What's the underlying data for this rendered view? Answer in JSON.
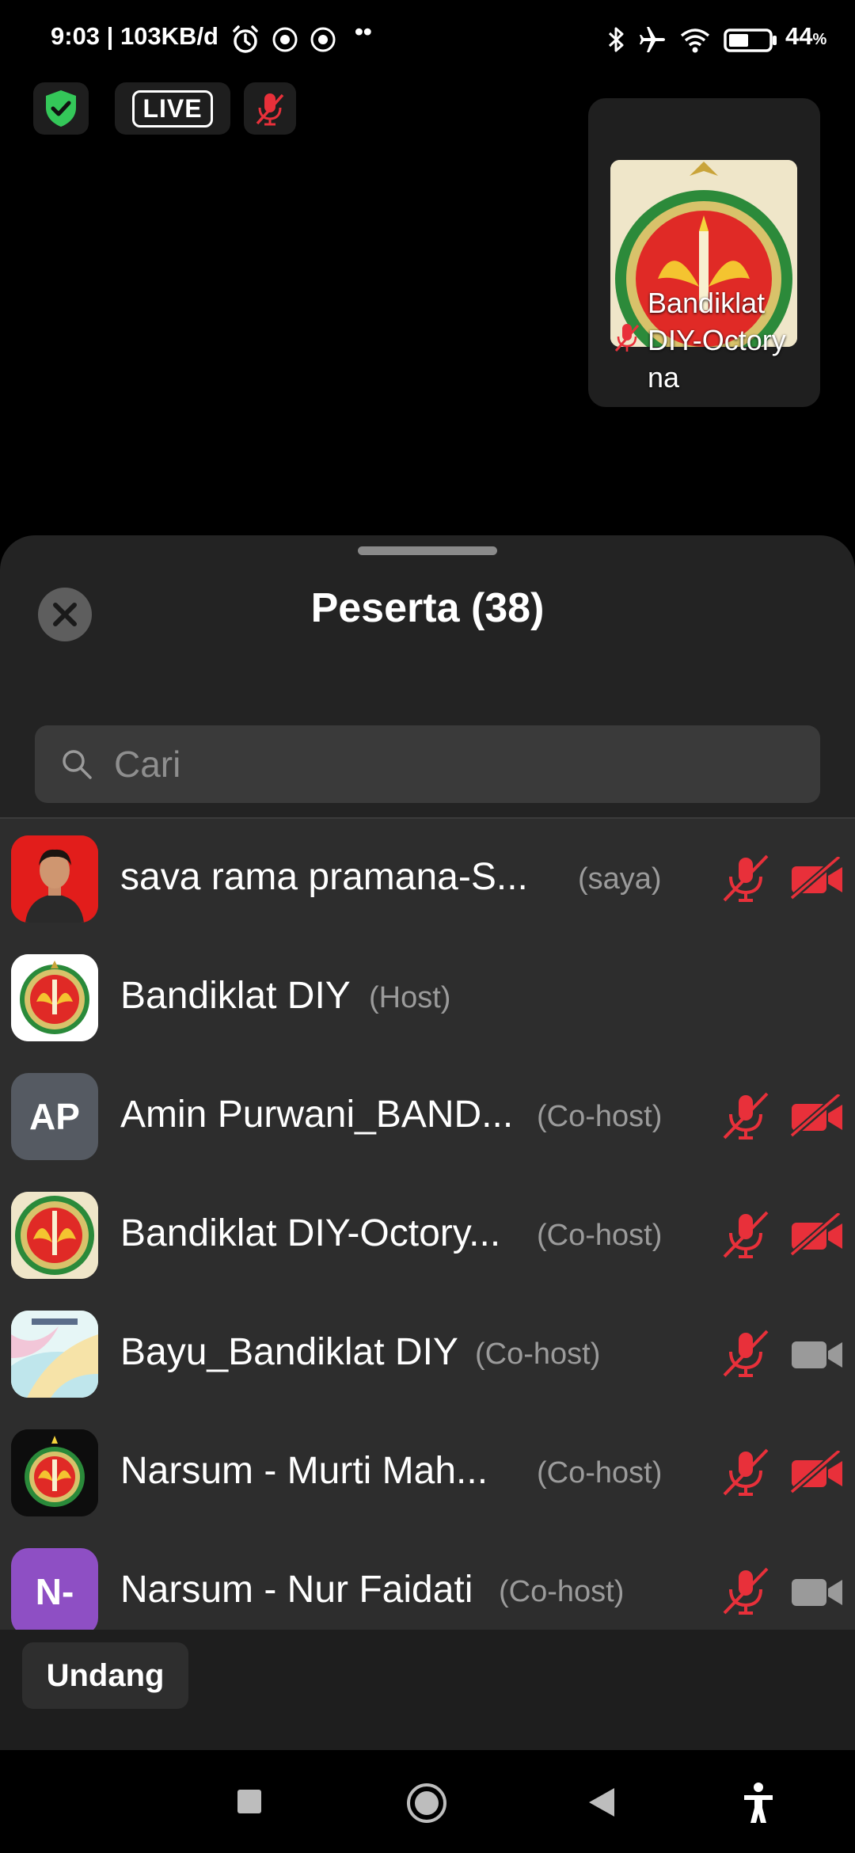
{
  "status_bar": {
    "time_speed": "9:03 | 103KB/d",
    "more": "••",
    "battery": "44",
    "battery_unit": "%"
  },
  "meeting": {
    "live_label": "LIVE",
    "video_tile_name": "Bandiklat DIY-Octory na"
  },
  "panel": {
    "title": "Peserta (38)",
    "search_placeholder": "Cari",
    "invite_label": "Undang"
  },
  "participants": [
    {
      "name": "sava rama pramana-S...",
      "role": "(saya)",
      "avatar_type": "photo",
      "mic_muted": true,
      "cam_off": true
    },
    {
      "name": "Bandiklat DIY",
      "role": "(Host)",
      "avatar_type": "emblem",
      "mic_muted": null,
      "cam_off": null
    },
    {
      "name": "Amin Purwani_BAND...",
      "role": "(Co-host)",
      "avatar_type": "initials",
      "initials": "AP",
      "avatar_color": "#555a62",
      "mic_muted": true,
      "cam_off": true
    },
    {
      "name": "Bandiklat DIY-Octory...",
      "role": "(Co-host)",
      "avatar_type": "emblem",
      "mic_muted": true,
      "cam_off": true
    },
    {
      "name": "Bayu_Bandiklat DIY",
      "role": "(Co-host)",
      "avatar_type": "abstract",
      "mic_muted": true,
      "cam_off": false
    },
    {
      "name": "Narsum - Murti Mah...",
      "role": "(Co-host)",
      "avatar_type": "emblem-dark",
      "mic_muted": true,
      "cam_off": true
    },
    {
      "name": "Narsum - Nur Faidati",
      "role": "(Co-host)",
      "avatar_type": "initials",
      "initials": "N-",
      "avatar_color": "#8e4fc4",
      "mic_muted": true,
      "cam_off": false
    }
  ],
  "colors": {
    "muted_red": "#e8303a",
    "cam_gray": "#9a9a9a",
    "shield_green": "#34c759"
  }
}
